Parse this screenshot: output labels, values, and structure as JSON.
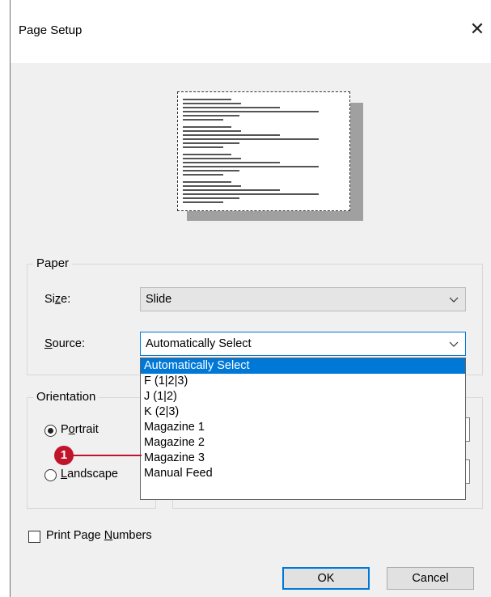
{
  "window": {
    "title": "Page Setup",
    "close_glyph": "✕"
  },
  "paper_group": {
    "label": "Paper",
    "size": {
      "label_prefix": "Si",
      "label_access_key": "z",
      "label_suffix": "e:",
      "value": "Slide"
    },
    "source": {
      "label_access_key": "S",
      "label_suffix": "ource:",
      "value": "Automatically Select",
      "options": [
        "Automatically Select",
        "F (1|2|3)",
        "J (1|2)",
        "K (2|3)",
        "Magazine 1",
        "Magazine 2",
        "Magazine 3",
        "Manual Feed"
      ],
      "selected_index": 0
    }
  },
  "orientation_group": {
    "label": "Orientation",
    "portrait": {
      "prefix": "P",
      "access_key": "o",
      "suffix": "rtrait",
      "checked": true
    },
    "landscape": {
      "prefix": "",
      "access_key": "L",
      "suffix": "andscape",
      "checked": false
    }
  },
  "print_page_numbers": {
    "prefix": "Print Page ",
    "access_key": "N",
    "suffix": "umbers",
    "checked": false
  },
  "buttons": {
    "ok": "OK",
    "cancel": "Cancel"
  },
  "callout": {
    "number": "1",
    "color": "#c0142a"
  },
  "colors": {
    "accent": "#0078d7",
    "dialog_bg": "#f0f0f0"
  }
}
